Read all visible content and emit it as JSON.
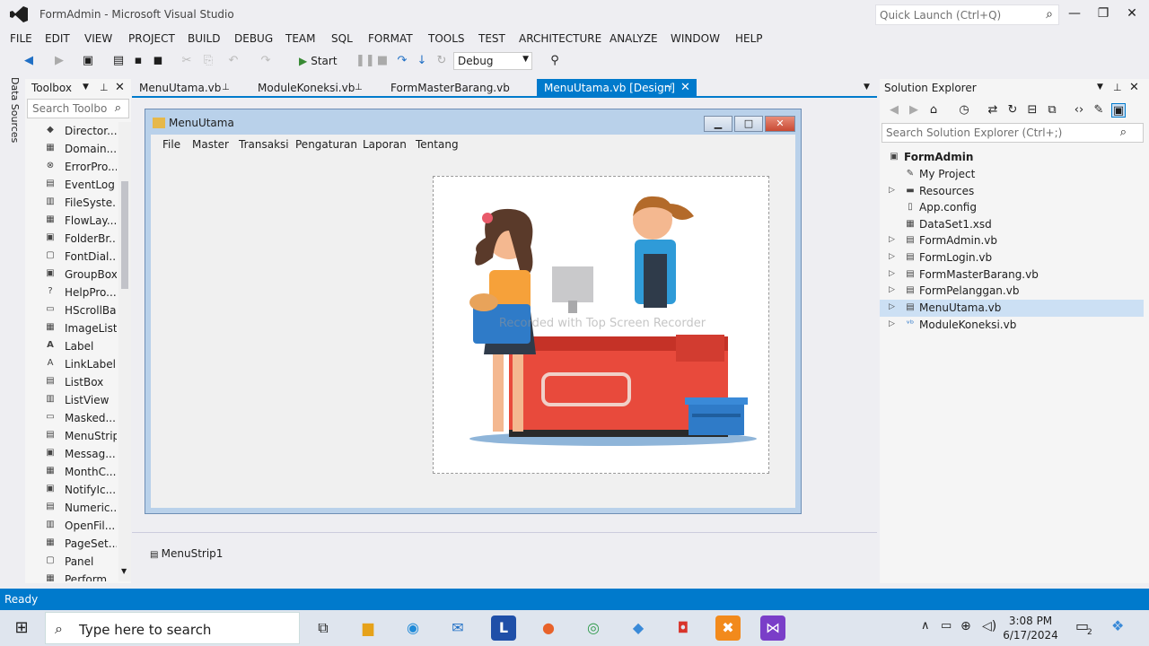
{
  "window": {
    "title": "FormAdmin - Microsoft Visual Studio",
    "quick_launch": "Quick Launch (Ctrl+Q)"
  },
  "menu": [
    "FILE",
    "EDIT",
    "VIEW",
    "PROJECT",
    "BUILD",
    "DEBUG",
    "TEAM",
    "SQL",
    "FORMAT",
    "TOOLS",
    "TEST",
    "ARCHITECTURE",
    "ANALYZE",
    "WINDOW",
    "HELP"
  ],
  "toolbar": {
    "start_label": "Start",
    "config": "Debug"
  },
  "data_sources": "Data Sources",
  "toolbox": {
    "title": "Toolbox",
    "search_placeholder": "Search Toolbo",
    "items": [
      "Director...",
      "Domain...",
      "ErrorPro...",
      "EventLog",
      "FileSyste...",
      "FlowLay...",
      "FolderBr...",
      "FontDial...",
      "GroupBox",
      "HelpPro...",
      "HScrollBar",
      "ImageList",
      "Label",
      "LinkLabel",
      "ListBox",
      "ListView",
      "Masked...",
      "MenuStrip",
      "Messag...",
      "MonthC...",
      "NotifyIc...",
      "Numeric...",
      "OpenFil...",
      "PageSet...",
      "Panel",
      "Perform..."
    ]
  },
  "tabs": [
    {
      "label": "MenuUtama.vb"
    },
    {
      "label": "ModuleKoneksi.vb"
    },
    {
      "label": "FormMasterBarang.vb"
    },
    {
      "label": "MenuUtama.vb [Design]"
    }
  ],
  "form": {
    "title": "MenuUtama",
    "menu": [
      "File",
      "Master",
      "Transaksi",
      "Pengaturan",
      "Laporan",
      "Tentang"
    ],
    "watermark": "Recorded with Top Screen Recorder",
    "tray_component": "MenuStrip1"
  },
  "solution": {
    "title": "Solution Explorer",
    "search_placeholder": "Search Solution Explorer (Ctrl+;)",
    "project": "FormAdmin",
    "items": [
      "My Project",
      "Resources",
      "App.config",
      "DataSet1.xsd",
      "FormAdmin.vb",
      "FormLogin.vb",
      "FormMasterBarang.vb",
      "FormPelanggan.vb",
      "MenuUtama.vb",
      "ModuleKoneksi.vb"
    ]
  },
  "status": "Ready",
  "taskbar": {
    "search": "Type here to search",
    "time": "3:08 PM",
    "date": "6/17/2024",
    "notification_count": "2"
  },
  "colors": {
    "accent": "#007acc",
    "form_border": "#b9d1ea"
  }
}
